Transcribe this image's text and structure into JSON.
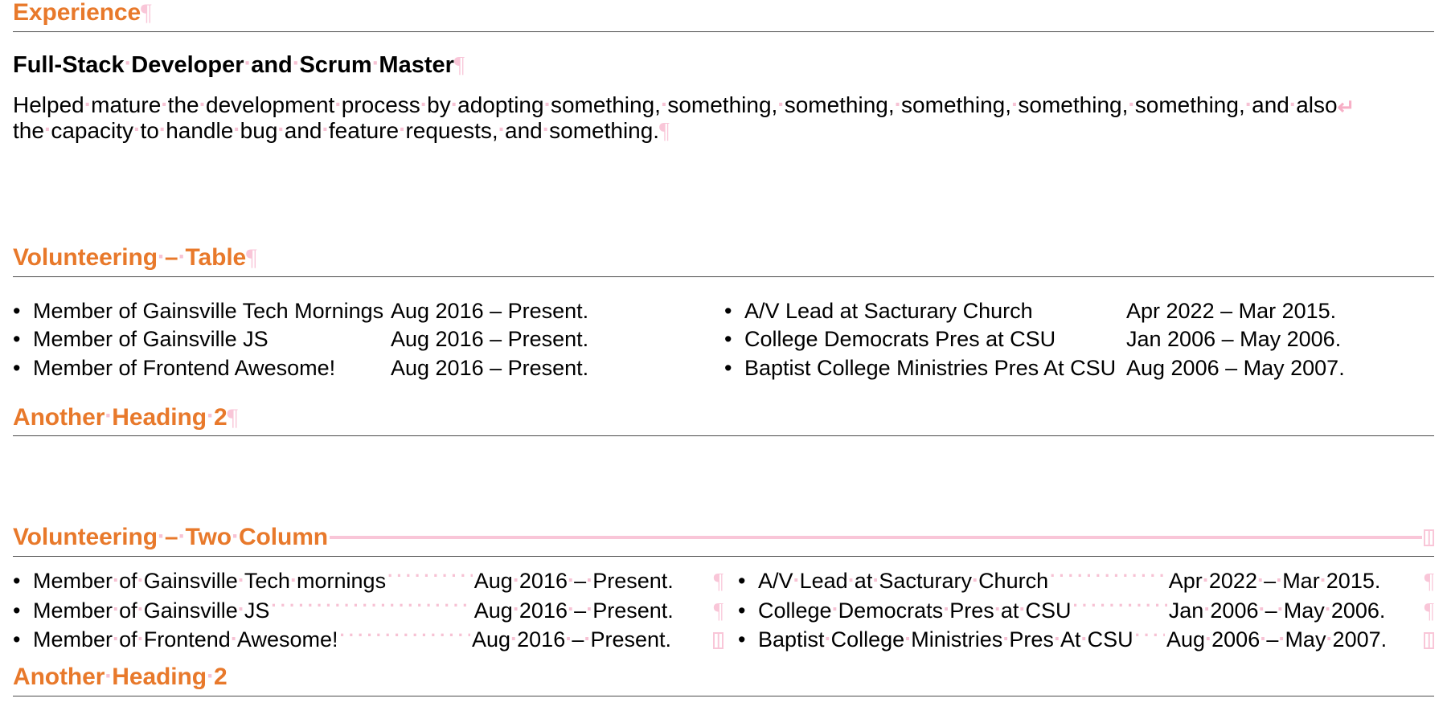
{
  "document": {
    "accent_color": "#E8792B",
    "formatting_mark_color": "#F9C6D8",
    "rule_color": "#4a4a4a"
  },
  "sections": {
    "experience": {
      "heading": "Experience",
      "job_title": "Full-Stack Developer and Scrum Master",
      "paragraph_line_1": "Helped mature the development process by adopting something, something, something, something, something, something, and also",
      "paragraph_line_2": "the capacity to handle bug and feature requests, and something."
    },
    "volunteering_table": {
      "heading": "Volunteering – Table",
      "rows": [
        {
          "left_org": "Member of Gainsville Tech Mornings",
          "left_date": "Aug 2016 – Present.",
          "right_org": "A/V Lead at Sacturary Church",
          "right_date": "Apr 2022 – Mar 2015."
        },
        {
          "left_org": "Member of Gainsville JS",
          "left_date": "Aug 2016 – Present.",
          "right_org": "College Democrats Pres at CSU",
          "right_date": "Jan 2006 – May 2006."
        },
        {
          "left_org": "Member of Frontend Awesome!",
          "left_date": "Aug 2016 – Present.",
          "right_org": "Baptist College Ministries Pres At CSU",
          "right_date": "Aug 2006 – May 2007."
        }
      ]
    },
    "another_heading_middle": {
      "heading": "Another Heading 2"
    },
    "volunteering_two_column": {
      "heading": "Volunteering – Two Column",
      "rows": [
        {
          "left_org": "Member of Gainsville Tech mornings",
          "left_date": "Aug 2016 – Present.",
          "right_org": "A/V Lead at Sacturary Church",
          "right_date": "Apr 2022 – Mar 2015."
        },
        {
          "left_org": "Member of Gainsville JS",
          "left_date": "Aug 2016 – Present.",
          "right_org": "College Democrats Pres at CSU",
          "right_date": "Jan 2006 – May 2006."
        },
        {
          "left_org": "Member of Frontend Awesome!",
          "left_date": "Aug 2016 – Present.",
          "right_org": "Baptist College Ministries Pres At CSU",
          "right_date": "Aug 2006 – May 2007."
        }
      ]
    },
    "another_heading_bottom": {
      "heading": "Another Heading 2"
    }
  },
  "formatting_marks": {
    "pilcrow": "¶",
    "space_dot": "·",
    "line_break": "↵",
    "bullet": "•",
    "cell_end": "cell-end-mark"
  }
}
